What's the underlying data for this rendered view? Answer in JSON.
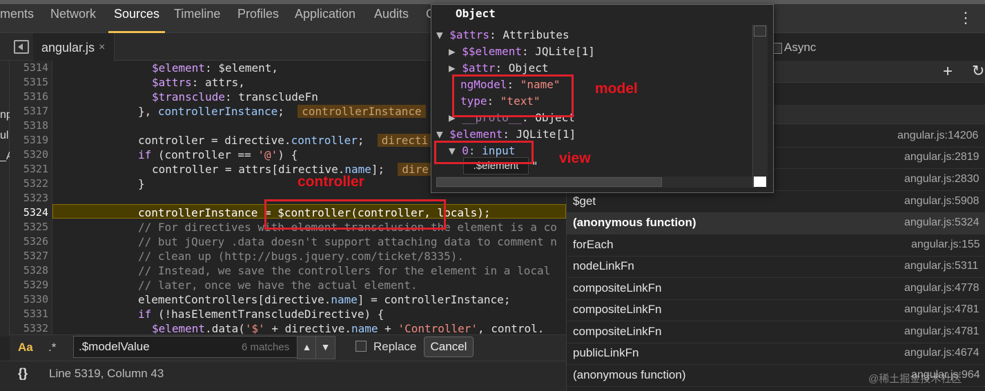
{
  "panel_tabs": [
    "ments",
    "Network",
    "Sources",
    "Timeline",
    "Profiles",
    "Application",
    "Audits",
    "C"
  ],
  "active_tab": "Sources",
  "kebab": "⋮",
  "file_tab": {
    "label": "angular.js",
    "close": "×"
  },
  "left_sliver": [
    "np",
    "ul",
    "_A"
  ],
  "editor": {
    "lines": [
      {
        "num": "5314"
      },
      {
        "num": "5315"
      },
      {
        "num": "5316"
      },
      {
        "num": "5317"
      },
      {
        "num": "5318"
      },
      {
        "num": "5319"
      },
      {
        "num": "5320"
      },
      {
        "num": "5321"
      },
      {
        "num": "5322"
      },
      {
        "num": "5323"
      },
      {
        "num": "5324"
      },
      {
        "num": "5325"
      },
      {
        "num": "5326"
      },
      {
        "num": "5327"
      },
      {
        "num": "5328"
      },
      {
        "num": "5329"
      },
      {
        "num": "5330"
      },
      {
        "num": "5331"
      },
      {
        "num": "5332"
      }
    ],
    "code": {
      "l5314": [
        "$element",
        ": $element,"
      ],
      "l5315": [
        "$attrs",
        ": attrs,"
      ],
      "l5316": [
        "$transclude",
        ": transcludeFn"
      ],
      "l5317": [
        "}, ",
        "controllerInstance",
        ";",
        "controllerInstance"
      ],
      "l5319": [
        "controller = directive.",
        "controller",
        ";",
        "directi"
      ],
      "l5320": [
        "if",
        " (controller == ",
        "'@'",
        ") {"
      ],
      "l5321": [
        "controller = attrs[directive.",
        "name",
        "];",
        "dire"
      ],
      "l5322": "}",
      "l5324": "controllerInstance = $controller(controller, locals);",
      "l5325": "// For directives with element transclusion the element is a co",
      "l5326": "// but jQuery .data doesn't support attaching data to comment n",
      "l5327": "// clean up (http://bugs.jquery.com/ticket/8335).",
      "l5328": "// Instead, we save the controllers for the element in a local",
      "l5329": "// later, once we have the actual element.",
      "l5330": [
        "elementControllers[directive.",
        "name",
        "] = controllerInstance;"
      ],
      "l5331": [
        "if",
        " (!hasElementTranscludeDirective) {"
      ],
      "l5332": [
        "$element",
        ".data(",
        "'$'",
        " + directive.",
        "name",
        " + ",
        "'Controller'",
        ", control."
      ]
    }
  },
  "find": {
    "aa": "Aa",
    "regex": ".*",
    "value": ".$modelValue",
    "matches": "6 matches",
    "up": "▲",
    "down": "▼",
    "replace_label": "Replace",
    "cancel": "Cancel"
  },
  "status": {
    "braces": "{}",
    "cursor": "Line 5319, Column 43"
  },
  "right": {
    "async_label": "Async",
    "plus": "+",
    "refresh": "↻",
    "call_stack": [
      {
        "name": "",
        "location": "angular.js:14206"
      },
      {
        "name": "",
        "location": "angular.js:2819"
      },
      {
        "name": "",
        "location": "angular.js:2830"
      },
      {
        "name": "$get",
        "location": "angular.js:5908"
      },
      {
        "name": "(anonymous function)",
        "location": "angular.js:5324"
      },
      {
        "name": "forEach",
        "location": "angular.js:155"
      },
      {
        "name": "nodeLinkFn",
        "location": "angular.js:5311"
      },
      {
        "name": "compositeLinkFn",
        "location": "angular.js:4778"
      },
      {
        "name": "compositeLinkFn",
        "location": "angular.js:4781"
      },
      {
        "name": "compositeLinkFn",
        "location": "angular.js:4781"
      },
      {
        "name": "publicLinkFn",
        "location": "angular.js:4674"
      },
      {
        "name": "(anonymous function)",
        "location": "angular.js:964"
      }
    ]
  },
  "popover": {
    "title": "Object",
    "rows": {
      "r1": [
        "$attrs",
        ": Attributes"
      ],
      "r2": [
        "$$element",
        ": JQLite[1]"
      ],
      "r3": [
        "$attr",
        ": Object"
      ],
      "r4": [
        "ngModel",
        ": ",
        "\"name\""
      ],
      "r5": [
        "type",
        ": ",
        "\"text\""
      ],
      "r6": [
        "__proto__",
        ": Object"
      ],
      "r7": [
        "$element",
        ": JQLite[1]"
      ],
      "r8": [
        "0",
        ": input"
      ],
      "r9": "\""
    },
    "tooltip": ".$element"
  },
  "annotations": {
    "model": "model",
    "view": "view",
    "controller": "controller"
  },
  "watermark": "@稀土掘金技术社区",
  "colors": {
    "accent": "#f0c050",
    "annotation": "#e0202a",
    "variable": "#d6a0ff",
    "string": "#f28b82"
  }
}
